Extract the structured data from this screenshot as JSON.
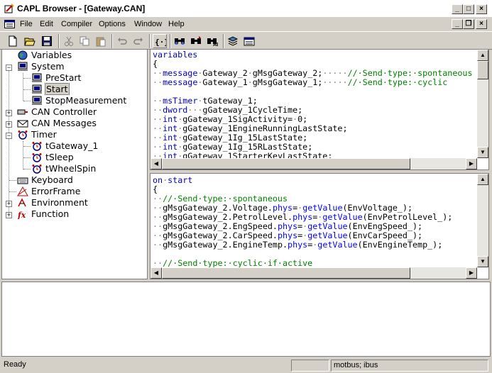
{
  "window": {
    "title": "CAPL Browser - [Gateway.CAN]"
  },
  "menu": [
    "File",
    "Edit",
    "Compiler",
    "Options",
    "Window",
    "Help"
  ],
  "toolbar": [
    "new-icon",
    "open-icon",
    "save-icon",
    "cut-icon",
    "copy-icon",
    "paste-icon",
    "undo-icon",
    "redo-icon",
    "braces-icon",
    "find-icon",
    "find-next-icon",
    "replace-icon",
    "compile-icon",
    "compile-all-icon"
  ],
  "tree": {
    "items": [
      {
        "label": "Variables"
      },
      {
        "label": "System"
      },
      {
        "label": "PreStart"
      },
      {
        "label": "Start"
      },
      {
        "label": "StopMeasurement"
      },
      {
        "label": "CAN Controller"
      },
      {
        "label": "CAN Messages"
      },
      {
        "label": "Timer"
      },
      {
        "label": "tGateway_1"
      },
      {
        "label": "tSleep"
      },
      {
        "label": "tWheelSpin"
      },
      {
        "label": "Keyboard"
      },
      {
        "label": "ErrorFrame"
      },
      {
        "label": "Environment"
      },
      {
        "label": "Function"
      }
    ]
  },
  "variables_code": [
    "variables",
    "{",
    "··message·Gateway_2·gMsgGateway_2;·····//·Send·type:·spontaneous",
    "··message·Gateway_1·gMsgGateway_1;·····//·Send·type:·cyclic",
    "",
    "··msTimer·tGateway_1;",
    "··dword···gGateway_1CycleTime;",
    "··int·gGateway_1SigActivity=·0;",
    "··int·gGateway_1EngineRunningLastState;",
    "··int·gGateway_1Ig_15LastState;",
    "··int·gGateway_1Ig_15RLastState;",
    "··int·gGateway_1StarterKeyLastState;"
  ],
  "handler_code": [
    "on·start",
    "{",
    "··//·Send·type:·spontaneous",
    "··gMsgGateway_2.Voltage.phys=·getValue(EnvVoltage_);",
    "··gMsgGateway_2.PetrolLevel.phys=·getValue(EnvPetrolLevel_);",
    "··gMsgGateway_2.EngSpeed.phys=·getValue(EnvEngSpeed_);",
    "··gMsgGateway_2.CarSpeed.phys=·getValue(EnvCarSpeed_);",
    "··gMsgGateway_2.EngineTemp.phys=·getValue(EnvEngineTemp_);",
    "",
    "··//·Send·type:·cyclic·if·active"
  ],
  "status": {
    "text": "Ready",
    "network": "motbus; ibus"
  }
}
